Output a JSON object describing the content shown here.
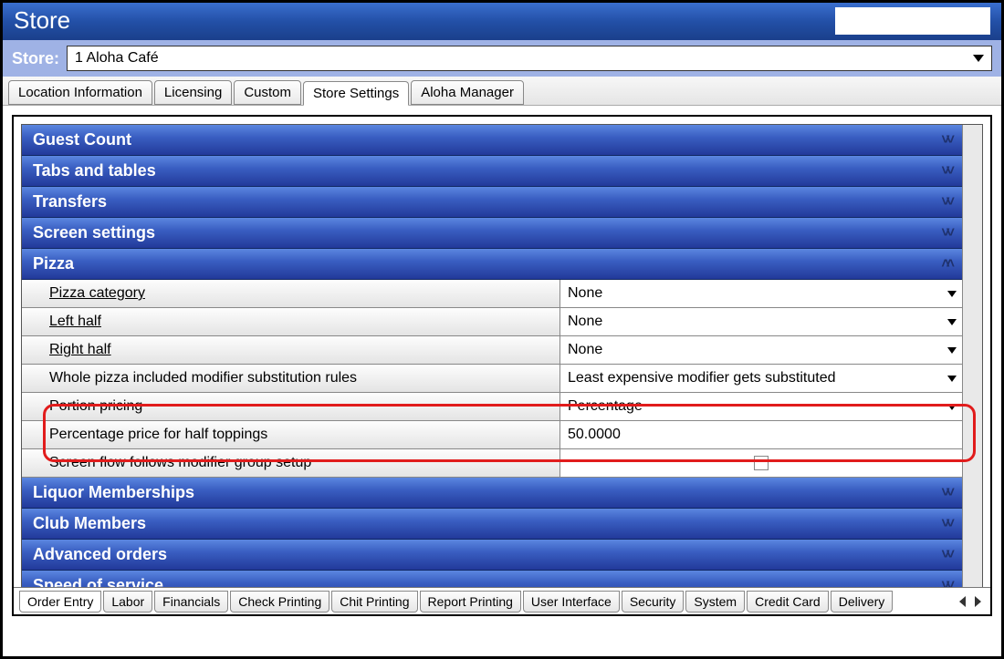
{
  "title": "Store",
  "storeLabel": "Store:",
  "storeSelected": "1 Aloha Café",
  "topTabs": [
    "Location Information",
    "Licensing",
    "Custom",
    "Store Settings",
    "Aloha Manager"
  ],
  "activeTopTab": 3,
  "sections": {
    "collapsed": [
      "Guest Count",
      "Tabs and tables",
      "Transfers",
      "Screen settings"
    ],
    "pizza": {
      "title": "Pizza",
      "props": [
        {
          "label": "Pizza category",
          "underline": true,
          "value": "None",
          "type": "dropdown"
        },
        {
          "label": "Left half",
          "underline": true,
          "value": "None",
          "type": "dropdown"
        },
        {
          "label": "Right half",
          "underline": true,
          "value": "None",
          "type": "dropdown"
        },
        {
          "label": "Whole pizza included modifier substitution rules",
          "underline": false,
          "value": "Least expensive modifier gets substituted",
          "type": "dropdown"
        },
        {
          "label": "Portion pricing",
          "underline": false,
          "value": "Percentage",
          "type": "dropdown"
        },
        {
          "label": "Percentage price for half toppings",
          "underline": false,
          "value": "50.0000",
          "type": "text"
        },
        {
          "label": "Screen flow follows modifier group setup",
          "underline": false,
          "value": "",
          "type": "checkbox"
        }
      ]
    },
    "collapsedAfter": [
      "Liquor Memberships",
      "Club Members",
      "Advanced orders",
      "Speed of service"
    ]
  },
  "bottomTabs": [
    "Order Entry",
    "Labor",
    "Financials",
    "Check Printing",
    "Chit Printing",
    "Report Printing",
    "User Interface",
    "Security",
    "System",
    "Credit Card",
    "Delivery"
  ],
  "activeBottomTab": 0
}
